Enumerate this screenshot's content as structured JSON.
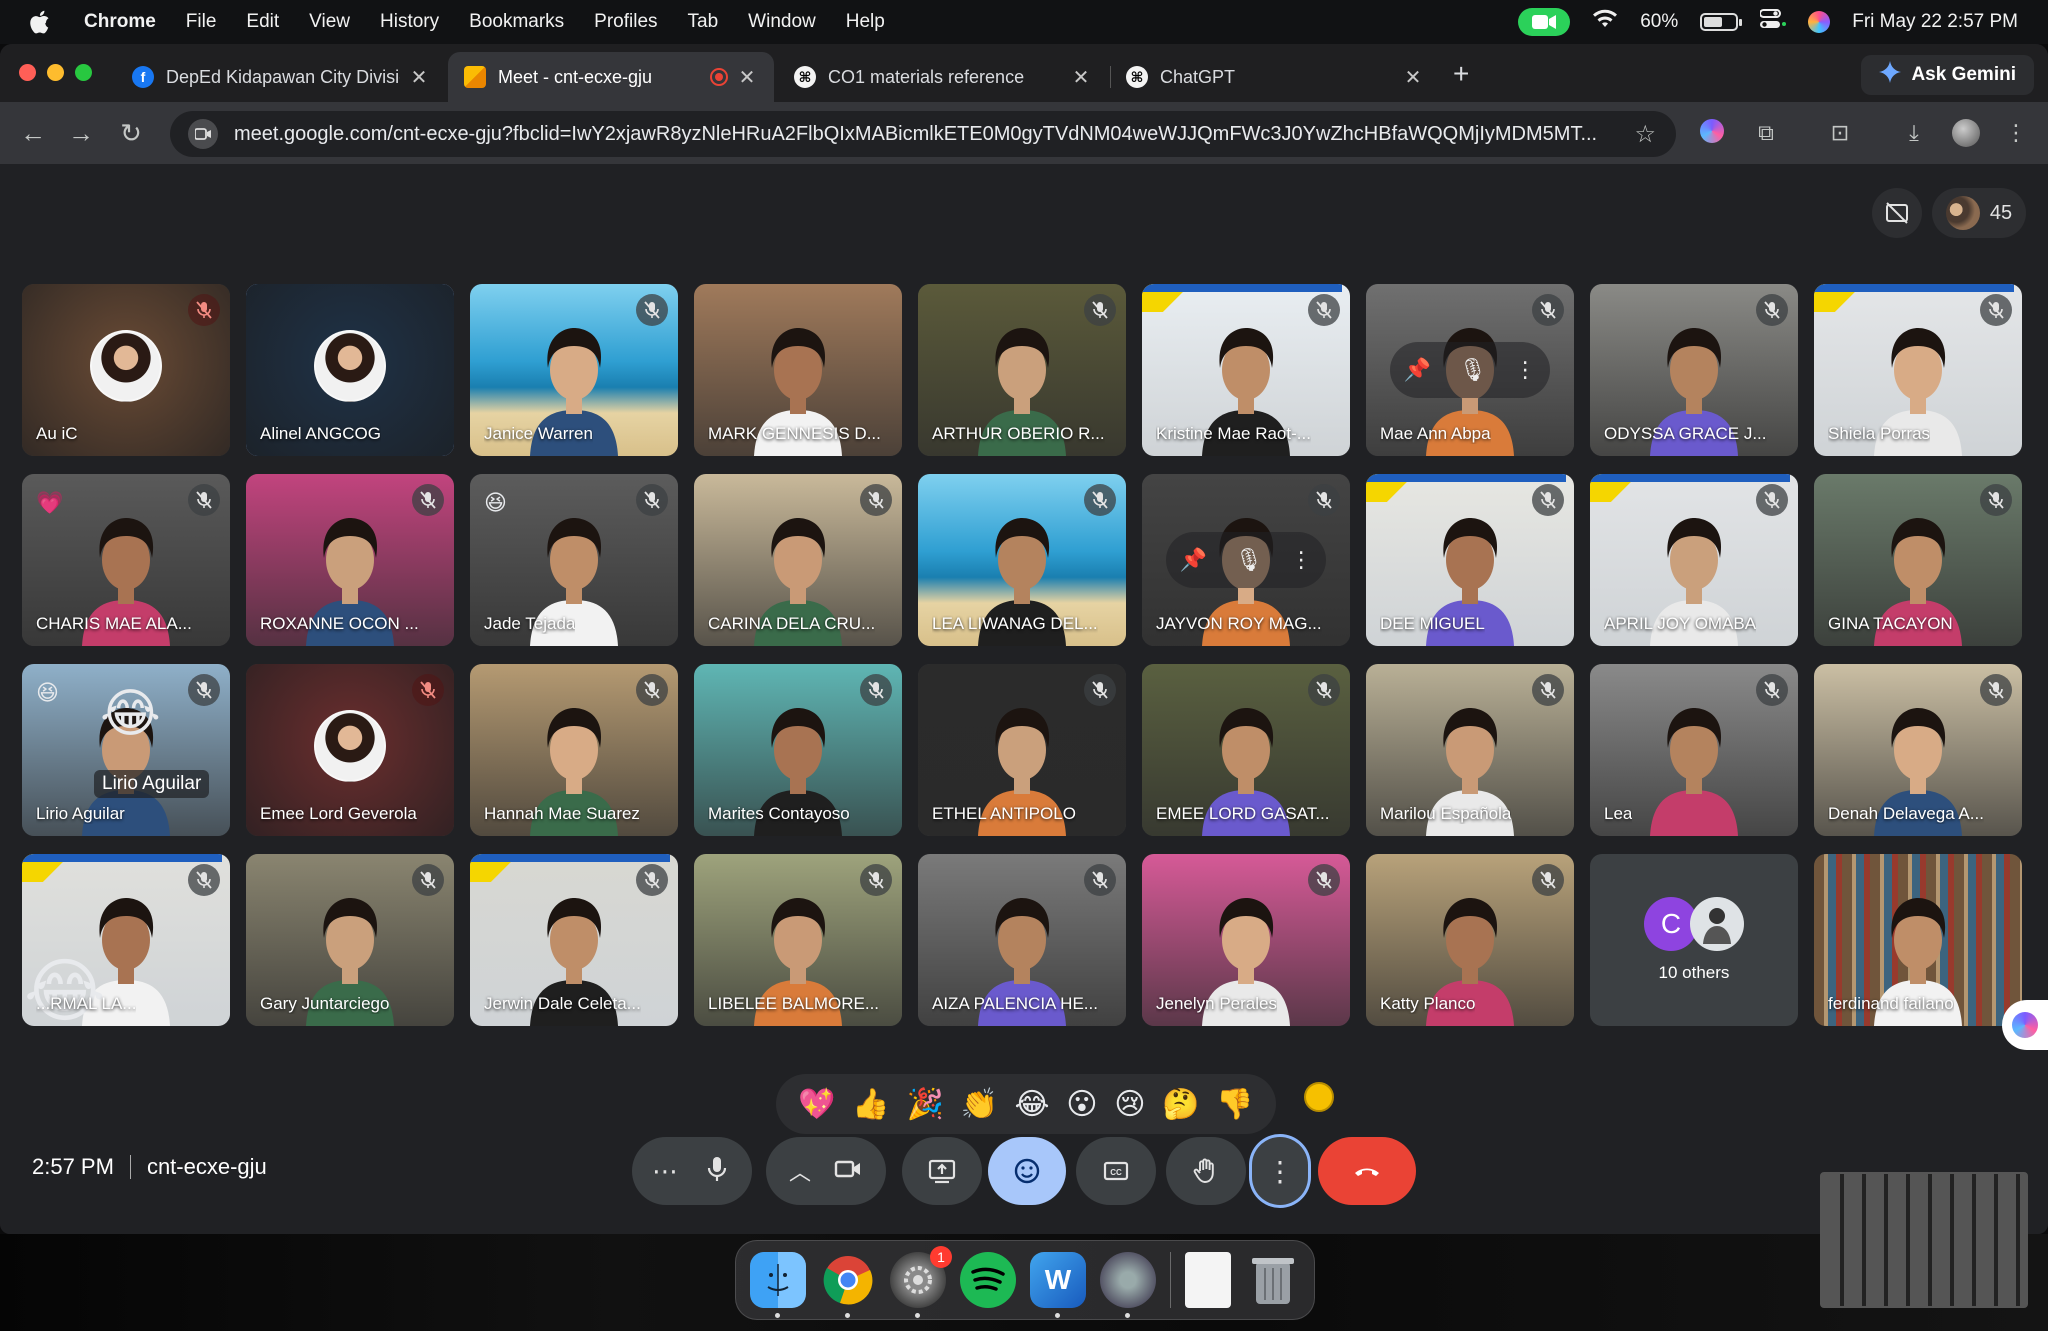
{
  "menubar": {
    "app": "Chrome",
    "menus": [
      "File",
      "Edit",
      "View",
      "History",
      "Bookmarks",
      "Profiles",
      "Tab",
      "Window",
      "Help"
    ],
    "battery": "60%",
    "datetime": "Fri May 22  2:57 PM"
  },
  "browser": {
    "tabs": [
      {
        "title": "DepEd Kidapawan City Divisio",
        "favicon": "facebook-icon"
      },
      {
        "title": "Meet - cnt-ecxe-gju",
        "favicon": "meet-icon",
        "recording": true
      },
      {
        "title": "CO1 materials reference",
        "favicon": "chatgpt-icon"
      },
      {
        "title": "ChatGPT",
        "favicon": "chatgpt-icon"
      }
    ],
    "ask_gemini": "Ask Gemini",
    "url": "meet.google.com/cnt-ecxe-gju?fbclid=IwY2xjawR8yzNleHRuA2FlbQIxMABicmlkETE0M0gyTVdNM04weWJJQmFWc3J0YwZhcHBfaWQQMjIyMDM5MT..."
  },
  "meet": {
    "participant_count": "45",
    "participants": [
      {
        "name": "Au iC",
        "mute": "red",
        "kind": "avatar",
        "bg": "#6a4b35"
      },
      {
        "name": "Alinel ANGCOG",
        "mute": "",
        "kind": "avatar",
        "bg": "#1f3247",
        "speaking": true
      },
      {
        "name": "Janice Warren",
        "mute": "grey",
        "kind": "beach",
        "bg": "#3aa6c9"
      },
      {
        "name": "MARK GENNESIS D...",
        "mute": "",
        "kind": "room",
        "bg": "#a07a5b"
      },
      {
        "name": "ARTHUR OBERIO R...",
        "mute": "grey",
        "kind": "room",
        "bg": "#5b5a3a"
      },
      {
        "name": "Kristine Mae Raot-...",
        "mute": "grey",
        "kind": "branded",
        "bg": "#e9eef2"
      },
      {
        "name": "Mae Ann Abpa",
        "mute": "grey",
        "kind": "pinned",
        "bg": "#707070"
      },
      {
        "name": "ODYSSA GRACE J...",
        "mute": "grey",
        "kind": "room",
        "bg": "#8a8a86"
      },
      {
        "name": "Shiela Porras",
        "mute": "grey",
        "kind": "branded",
        "bg": "#e4e6e8"
      },
      {
        "name": "CHARIS MAE ALA...",
        "mute": "grey",
        "kind": "room",
        "bg": "#5a5a5a",
        "react": "💗"
      },
      {
        "name": "ROXANNE OCON ...",
        "mute": "grey",
        "kind": "room",
        "bg": "#c2447e"
      },
      {
        "name": "Jade Tejada",
        "mute": "grey",
        "kind": "room",
        "bg": "#5c5c5c",
        "react": "😆"
      },
      {
        "name": "CARINA DELA CRU...",
        "mute": "grey",
        "kind": "room",
        "bg": "#c9b99a"
      },
      {
        "name": "LEA LIWANAG DEL...",
        "mute": "grey",
        "kind": "beach",
        "bg": "#2e8fc2"
      },
      {
        "name": "JAYVON ROY MAG...",
        "mute": "grey",
        "kind": "pinned",
        "bg": "#444"
      },
      {
        "name": "DEE MIGUEL",
        "mute": "grey",
        "kind": "branded",
        "bg": "#e7e7e2"
      },
      {
        "name": "APRIL JOY OMABA",
        "mute": "grey",
        "kind": "branded",
        "bg": "#e2e4e6"
      },
      {
        "name": "GINA TACAYON",
        "mute": "grey",
        "kind": "room",
        "bg": "#6a7a6a"
      },
      {
        "name": "Lirio Aguilar",
        "mute": "grey",
        "kind": "room",
        "bg": "#8fb0c9",
        "react": "😆",
        "big_emoji": "😂",
        "tag": "Lirio Aguilar"
      },
      {
        "name": "Emee Lord Geverola",
        "mute": "red",
        "kind": "avatar",
        "bg": "#6b2e2e"
      },
      {
        "name": "Hannah Mae Suarez",
        "mute": "grey",
        "kind": "room",
        "bg": "#b59a72"
      },
      {
        "name": "Marites Contayoso",
        "mute": "grey",
        "kind": "room",
        "bg": "#5fb6b4"
      },
      {
        "name": "ETHEL ANTIPOLO",
        "mute": "grey",
        "kind": "room",
        "bg": "#2b2b2b"
      },
      {
        "name": "EMEE LORD GASAT...",
        "mute": "grey",
        "kind": "room",
        "bg": "#5a6040"
      },
      {
        "name": "Marilou Española",
        "mute": "grey",
        "kind": "room",
        "bg": "#b9b096"
      },
      {
        "name": "Lea",
        "mute": "grey",
        "kind": "room",
        "bg": "#8a8a8a"
      },
      {
        "name": "Denah Delavega A...",
        "mute": "grey",
        "kind": "room",
        "bg": "#cbbfa4"
      },
      {
        "name": "...RMAL LA...",
        "mute": "grey",
        "kind": "branded",
        "bg": "#e0e0dc",
        "big_emoji": "😂"
      },
      {
        "name": "Gary Juntarciego",
        "mute": "grey",
        "kind": "room",
        "bg": "#8a8570"
      },
      {
        "name": "Jerwin Dale Celeta...",
        "mute": "grey",
        "kind": "branded",
        "bg": "#d8d8d2"
      },
      {
        "name": "LIBELEE BALMORE...",
        "mute": "grey",
        "kind": "room",
        "bg": "#9ea37c"
      },
      {
        "name": "AIZA PALENCIA HE...",
        "mute": "grey",
        "kind": "room",
        "bg": "#7a7a7a"
      },
      {
        "name": "Jenelyn Perales",
        "mute": "grey",
        "kind": "room",
        "bg": "#d65a97"
      },
      {
        "name": "Katty Planco",
        "mute": "grey",
        "kind": "room",
        "bg": "#b8a27a"
      },
      {
        "name": "10 others",
        "kind": "others",
        "avatar_letter": "C"
      },
      {
        "name": "ferdinand failano",
        "mute": "",
        "kind": "library",
        "bg": "#5b4a3a"
      }
    ],
    "reactions": [
      "💖",
      "👍",
      "🎉",
      "👏",
      "😂",
      "😮",
      "😢",
      "🤔",
      "👎"
    ],
    "time": "2:57 PM",
    "meeting_code": "cnt-ecxe-gju"
  },
  "dock": {
    "apps": [
      "finder-icon",
      "chrome-icon",
      "system-settings-icon",
      "spotify-icon",
      "word-icon",
      "automator-icon",
      "document-icon",
      "trash-icon"
    ],
    "settings_badge": "1"
  }
}
